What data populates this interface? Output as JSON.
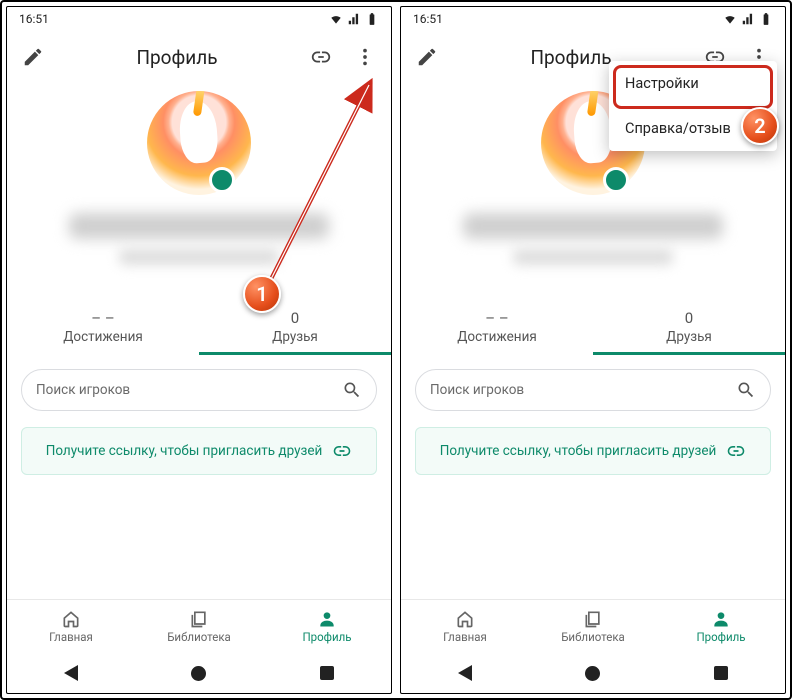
{
  "status": {
    "time": "16:51"
  },
  "appbar": {
    "title": "Профиль"
  },
  "tabs": {
    "achievements": {
      "value": "– –",
      "label": "Достижения"
    },
    "friends": {
      "value": "0",
      "label": "Друзья"
    }
  },
  "search": {
    "placeholder": "Поиск игроков"
  },
  "invite": {
    "text": "Получите ссылку, чтобы пригласить друзей"
  },
  "bottomnav": {
    "home": "Главная",
    "library": "Библиотека",
    "profile": "Профиль"
  },
  "menu": {
    "settings": "Настройки",
    "help": "Справка/отзыв"
  },
  "callout": {
    "one": "1",
    "two": "2"
  }
}
